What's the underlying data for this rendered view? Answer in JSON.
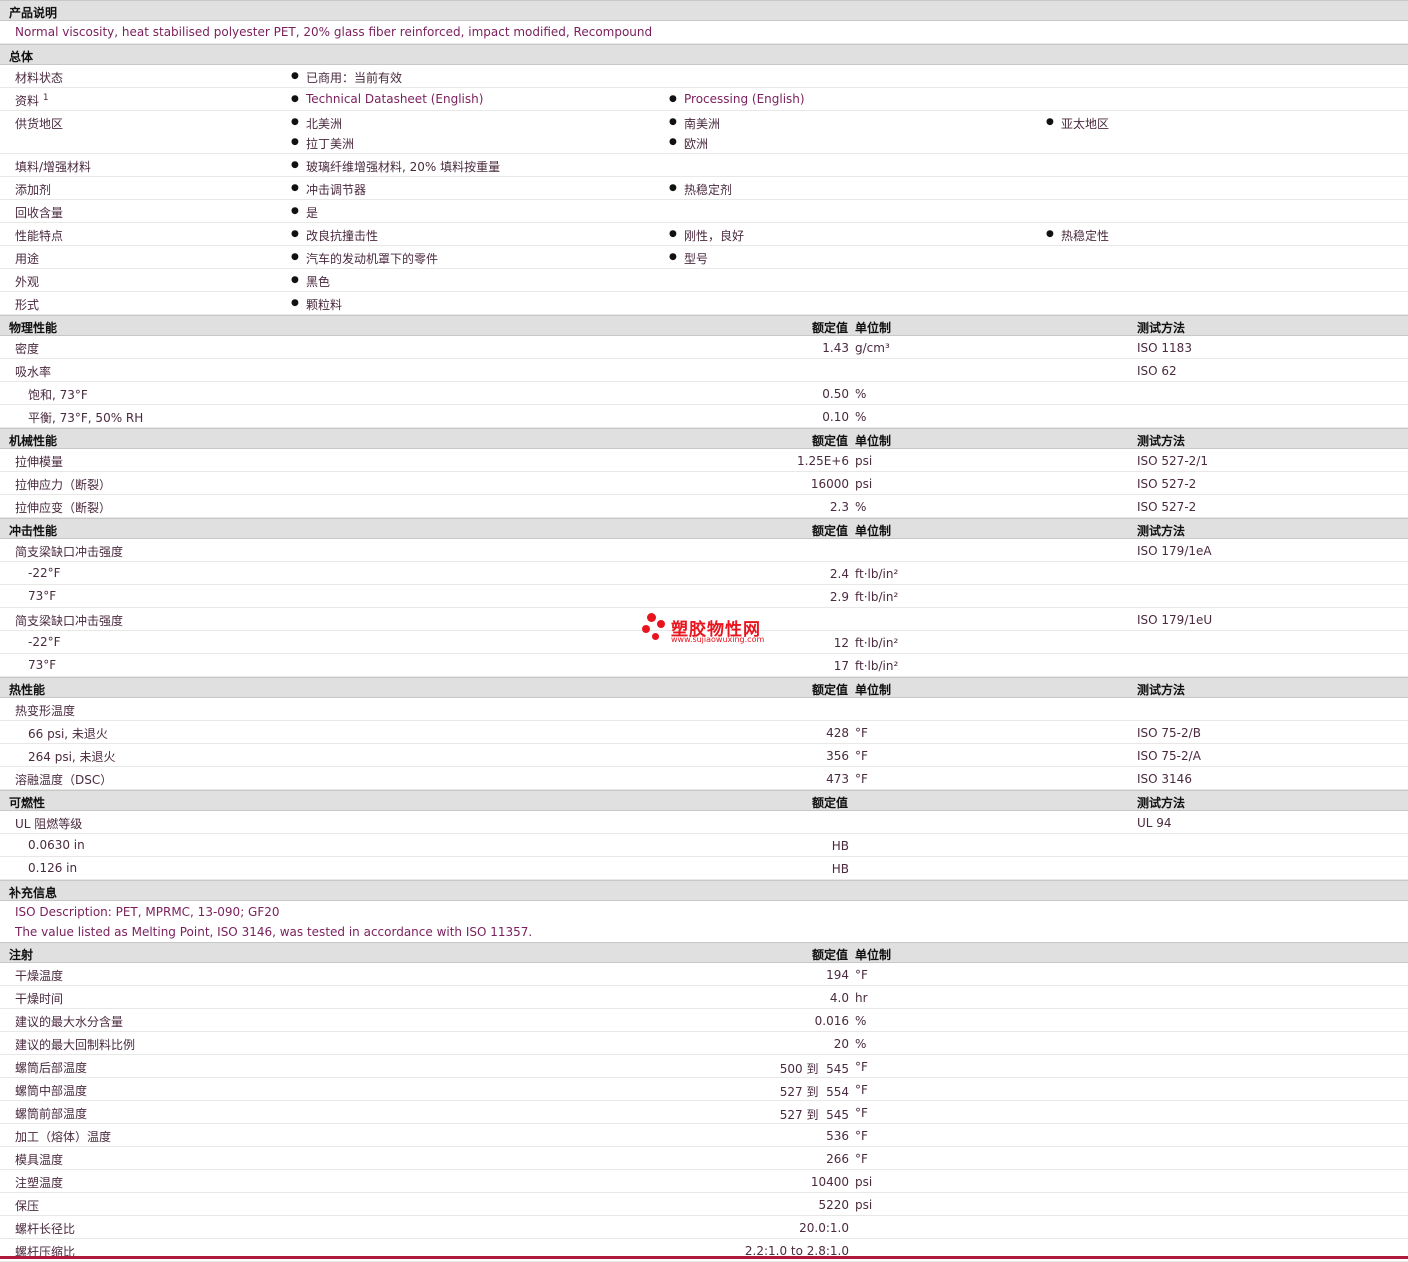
{
  "desc_section": {
    "title": "产品说明",
    "text": "Normal viscosity, heat stabilised polyester PET, 20% glass fiber reinforced, impact modified, Recompound"
  },
  "general": {
    "title": "总体",
    "material_status": {
      "label": "材料状态",
      "value": "已商用：当前有效"
    },
    "documents": {
      "label": "资料",
      "sup": "1",
      "doc1": "Technical Datasheet (English)",
      "doc2": "Processing (English)"
    },
    "availability": {
      "label": "供货地区",
      "r1": [
        "北美洲",
        "南美洲",
        "亚太地区"
      ],
      "r2": [
        "拉丁美洲",
        "欧洲"
      ]
    },
    "filler": {
      "label": "填料/增强材料",
      "value": "玻璃纤维增强材料, 20% 填料按重量"
    },
    "additives": {
      "label": "添加剂",
      "v1": "冲击调节器",
      "v2": "热稳定剂"
    },
    "recycled": {
      "label": "回收含量",
      "value": "是"
    },
    "features": {
      "label": "性能特点",
      "v1": "改良抗撞击性",
      "v2": "刚性，良好",
      "v3": "热稳定性"
    },
    "uses": {
      "label": "用途",
      "v1": "汽车的发动机罩下的零件",
      "v2": "型号"
    },
    "appearance": {
      "label": "外观",
      "value": "黑色"
    },
    "form": {
      "label": "形式",
      "value": "颗粒料"
    }
  },
  "headers": {
    "value": "额定值",
    "unit": "单位制",
    "method": "测试方法"
  },
  "physical": {
    "title": "物理性能",
    "rows": [
      {
        "label": "密度",
        "value": "1.43",
        "unit": "g/cm³",
        "method": "ISO 1183"
      },
      {
        "label": "吸水率",
        "value": "",
        "unit": "",
        "method": "ISO 62"
      },
      {
        "label": "饱和, 73°F",
        "value": "0.50",
        "unit": "%",
        "method": ""
      },
      {
        "label": "平衡, 73°F, 50% RH",
        "value": "0.10",
        "unit": "%",
        "method": ""
      }
    ]
  },
  "mechanical": {
    "title": "机械性能",
    "rows": [
      {
        "label": "拉伸模量",
        "value": "1.25E+6",
        "unit": "psi",
        "method": "ISO 527-2/1"
      },
      {
        "label": "拉伸应力（断裂）",
        "value": "16000",
        "unit": "psi",
        "method": "ISO 527-2"
      },
      {
        "label": "拉伸应变（断裂）",
        "value": "2.3",
        "unit": "%",
        "method": "ISO 527-2"
      }
    ]
  },
  "impact": {
    "title": "冲击性能",
    "rows": [
      {
        "label": "简支梁缺口冲击强度",
        "value": "",
        "unit": "",
        "method": "ISO 179/1eA"
      },
      {
        "label": "-22°F",
        "value": "2.4",
        "unit": "ft·lb/in²",
        "method": ""
      },
      {
        "label": "73°F",
        "value": "2.9",
        "unit": "ft·lb/in²",
        "method": ""
      },
      {
        "label": "简支梁缺口冲击强度",
        "value": "",
        "unit": "",
        "method": "ISO 179/1eU"
      },
      {
        "label": "-22°F",
        "value": "12",
        "unit": "ft·lb/in²",
        "method": ""
      },
      {
        "label": "73°F",
        "value": "17",
        "unit": "ft·lb/in²",
        "method": ""
      }
    ]
  },
  "thermal": {
    "title": "热性能",
    "rows": [
      {
        "label": "热变形温度",
        "value": "",
        "unit": "",
        "method": ""
      },
      {
        "label": "66 psi, 未退火",
        "value": "428",
        "unit": "°F",
        "method": "ISO 75-2/B"
      },
      {
        "label": "264 psi, 未退火",
        "value": "356",
        "unit": "°F",
        "method": "ISO 75-2/A"
      },
      {
        "label": "溶融温度（DSC）",
        "value": "473",
        "unit": "°F",
        "method": "ISO 3146"
      }
    ]
  },
  "flammability": {
    "title": "可燃性",
    "rows": [
      {
        "label": "UL 阻燃等级",
        "value": "",
        "method": "UL 94"
      },
      {
        "label": "0.0630 in",
        "value": "HB",
        "method": ""
      },
      {
        "label": "0.126 in",
        "value": "HB",
        "method": ""
      }
    ]
  },
  "supplement": {
    "title": "补充信息",
    "line1": "ISO Description: PET, MPRMC, 13-090; GF20",
    "line2": "The value listed as Melting Point, ISO 3146, was tested in accordance with ISO 11357."
  },
  "injection": {
    "title": "注射",
    "rows": [
      {
        "label": "干燥温度",
        "value": "194",
        "unit": "°F"
      },
      {
        "label": "干燥时间",
        "value": "4.0",
        "unit": "hr"
      },
      {
        "label": "建议的最大水分含量",
        "value": "0.016",
        "unit": "%"
      },
      {
        "label": "建议的最大回制料比例",
        "value": "20",
        "unit": "%"
      },
      {
        "label": "螺筒后部温度",
        "value": "500 到  545",
        "unit": "°F"
      },
      {
        "label": "螺筒中部温度",
        "value": "527 到  554",
        "unit": "°F"
      },
      {
        "label": "螺筒前部温度",
        "value": "527 到  545",
        "unit": "°F"
      },
      {
        "label": "加工（熔体）温度",
        "value": "536",
        "unit": "°F"
      },
      {
        "label": "模具温度",
        "value": "266",
        "unit": "°F"
      },
      {
        "label": "注塑温度",
        "value": "10400",
        "unit": "psi"
      },
      {
        "label": "保压",
        "value": "5220",
        "unit": "psi"
      },
      {
        "label": "螺杆长径比",
        "value": "20.0:1.0",
        "unit": ""
      },
      {
        "label": "螺杆压缩比",
        "value": "2.2:1.0 to 2.8:1.0",
        "unit": ""
      }
    ]
  },
  "watermark": {
    "brand": "塑胶物性网",
    "url": "www.sujiaowuxing.com",
    "color": "#e8141e"
  }
}
